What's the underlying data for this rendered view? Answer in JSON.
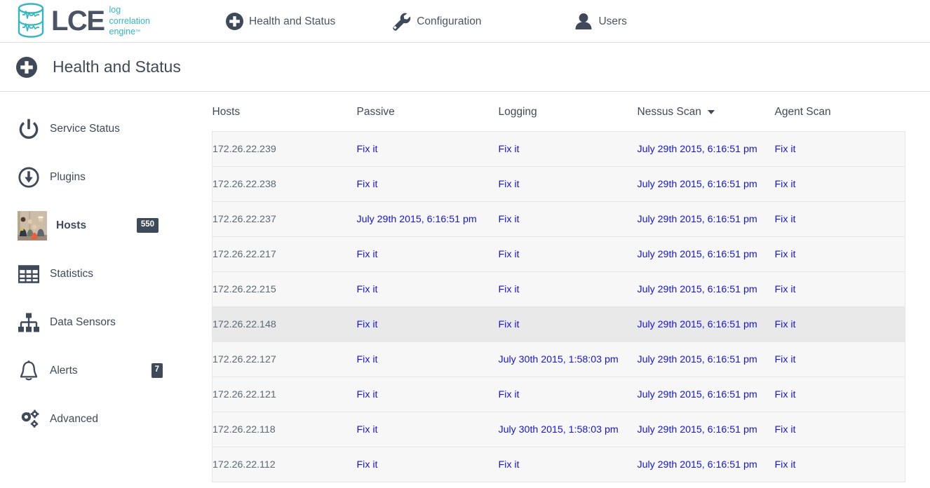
{
  "brand": {
    "word": "LCE",
    "tagline_line1": "log",
    "tagline_line2": "correlation",
    "tagline_line3": "engine",
    "trademark": "™",
    "accent_color": "#35b5c0",
    "word_color": "#4a5464"
  },
  "topnav": {
    "items": [
      {
        "label": "Health and Status",
        "icon": "plus-circle-icon"
      },
      {
        "label": "Configuration",
        "icon": "wrench-icon"
      },
      {
        "label": "Users",
        "icon": "user-icon"
      }
    ]
  },
  "pagehead": {
    "icon": "plus-circle-icon",
    "title": "Health and Status"
  },
  "sidebar": {
    "items": [
      {
        "label": "Service Status",
        "icon": "power-icon",
        "badge": null,
        "active": false
      },
      {
        "label": "Plugins",
        "icon": "download-icon",
        "badge": null,
        "active": false
      },
      {
        "label": "Hosts",
        "icon": "photo-thumbnail",
        "badge": "550",
        "active": true
      },
      {
        "label": "Statistics",
        "icon": "table-grid-icon",
        "badge": null,
        "active": false
      },
      {
        "label": "Data Sensors",
        "icon": "sitemap-icon",
        "badge": null,
        "active": false
      },
      {
        "label": "Alerts",
        "icon": "bell-icon",
        "badge": "7",
        "active": false
      },
      {
        "label": "Advanced",
        "icon": "gears-icon",
        "badge": null,
        "active": false
      }
    ]
  },
  "table": {
    "columns": [
      {
        "label": "Hosts",
        "sorted": false
      },
      {
        "label": "Passive",
        "sorted": false
      },
      {
        "label": "Logging",
        "sorted": false
      },
      {
        "label": "Nessus Scan",
        "sorted": true,
        "sort_icon": "caret-down-icon"
      },
      {
        "label": "Agent Scan",
        "sorted": false
      }
    ],
    "link_color": "#1414e0",
    "fix_label": "Fix it",
    "rows": [
      {
        "host": "172.26.22.239",
        "passive": "Fix it",
        "logging": "Fix it",
        "nessus": "July 29th 2015, 6:16:51 pm",
        "agent": "Fix it",
        "hovered": false
      },
      {
        "host": "172.26.22.238",
        "passive": "Fix it",
        "logging": "Fix it",
        "nessus": "July 29th 2015, 6:16:51 pm",
        "agent": "Fix it",
        "hovered": false
      },
      {
        "host": "172.26.22.237",
        "passive": "July 29th 2015, 6:16:51 pm",
        "logging": "Fix it",
        "nessus": "July 29th 2015, 6:16:51 pm",
        "agent": "Fix it",
        "hovered": false
      },
      {
        "host": "172.26.22.217",
        "passive": "Fix it",
        "logging": "Fix it",
        "nessus": "July 29th 2015, 6:16:51 pm",
        "agent": "Fix it",
        "hovered": false
      },
      {
        "host": "172.26.22.215",
        "passive": "Fix it",
        "logging": "Fix it",
        "nessus": "July 29th 2015, 6:16:51 pm",
        "agent": "Fix it",
        "hovered": false
      },
      {
        "host": "172.26.22.148",
        "passive": "Fix it",
        "logging": "Fix it",
        "nessus": "July 29th 2015, 6:16:51 pm",
        "agent": "Fix it",
        "hovered": true
      },
      {
        "host": "172.26.22.127",
        "passive": "Fix it",
        "logging": "July 30th 2015, 1:58:03 pm",
        "nessus": "July 29th 2015, 6:16:51 pm",
        "agent": "Fix it",
        "hovered": false
      },
      {
        "host": "172.26.22.121",
        "passive": "Fix it",
        "logging": "Fix it",
        "nessus": "July 29th 2015, 6:16:51 pm",
        "agent": "Fix it",
        "hovered": false
      },
      {
        "host": "172.26.22.118",
        "passive": "Fix it",
        "logging": "July 30th 2015, 1:58:03 pm",
        "nessus": "July 29th 2015, 6:16:51 pm",
        "agent": "Fix it",
        "hovered": false
      },
      {
        "host": "172.26.22.112",
        "passive": "Fix it",
        "logging": "Fix it",
        "nessus": "July 29th 2015, 6:16:51 pm",
        "agent": "Fix it",
        "hovered": false
      }
    ]
  }
}
